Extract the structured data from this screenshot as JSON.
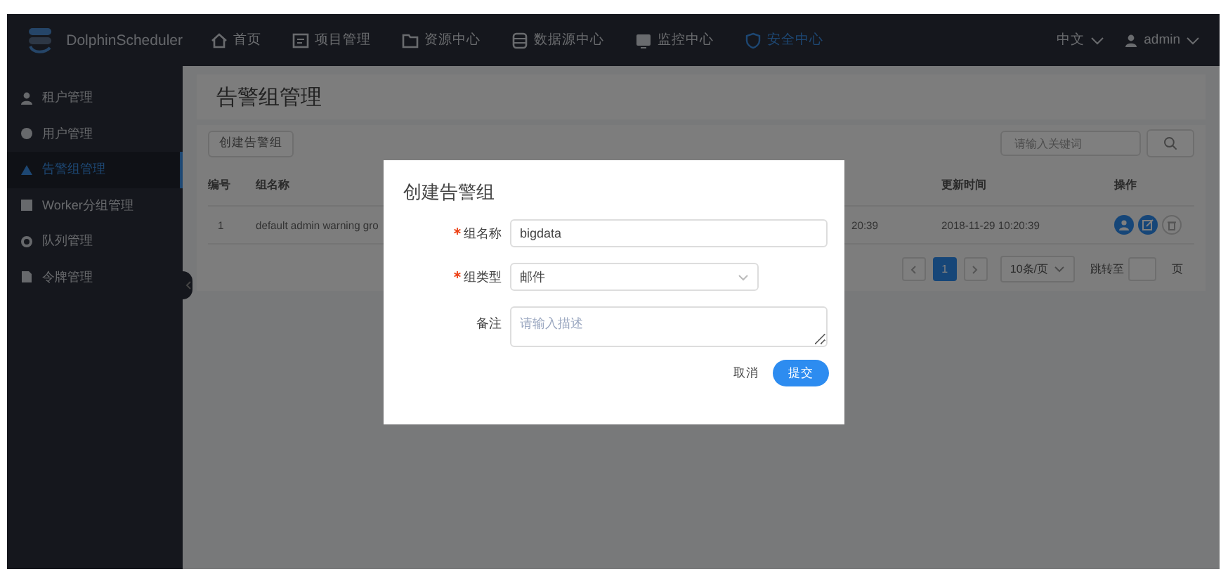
{
  "header": {
    "logo_text": "DolphinScheduler",
    "nav": [
      {
        "label": "首页",
        "selected": false
      },
      {
        "label": "项目管理",
        "selected": false
      },
      {
        "label": "资源中心",
        "selected": false
      },
      {
        "label": "数据源中心",
        "selected": false
      },
      {
        "label": "监控中心",
        "selected": false
      },
      {
        "label": "安全中心",
        "selected": true
      }
    ],
    "language": "中文",
    "user": "admin"
  },
  "sidebar": {
    "items": [
      {
        "label": "租户管理",
        "selected": false
      },
      {
        "label": "用户管理",
        "selected": false
      },
      {
        "label": "告警组管理",
        "selected": true
      },
      {
        "label": "Worker分组管理",
        "selected": false
      },
      {
        "label": "队列管理",
        "selected": false
      },
      {
        "label": "令牌管理",
        "selected": false
      }
    ]
  },
  "page": {
    "title": "告警组管理",
    "create_button": "创建告警组",
    "search": {
      "placeholder": "请输入关键词"
    },
    "table": {
      "columns": [
        "编号",
        "组名称",
        "",
        "更新时间",
        "操作"
      ],
      "rows": [
        {
          "cells": [
            "1",
            "default admin warning gro",
            "20:39",
            "2018-11-29 10:20:39"
          ]
        }
      ]
    },
    "pagination": {
      "pages": [
        {
          "label": "1",
          "selected": true
        }
      ],
      "page_size": "10条/页",
      "jump_label": "跳转至",
      "page_unit": "页"
    }
  },
  "dialog": {
    "title": "创建告警组",
    "fields": [
      {
        "kind": "input",
        "label": "组名称",
        "required": true,
        "value": "bigdata"
      },
      {
        "kind": "select",
        "label": "组类型",
        "required": true,
        "value": "邮件"
      },
      {
        "kind": "textarea",
        "label": "备注",
        "required": false,
        "placeholder": "请输入描述"
      }
    ],
    "cancel": "取消",
    "submit": "提交"
  }
}
